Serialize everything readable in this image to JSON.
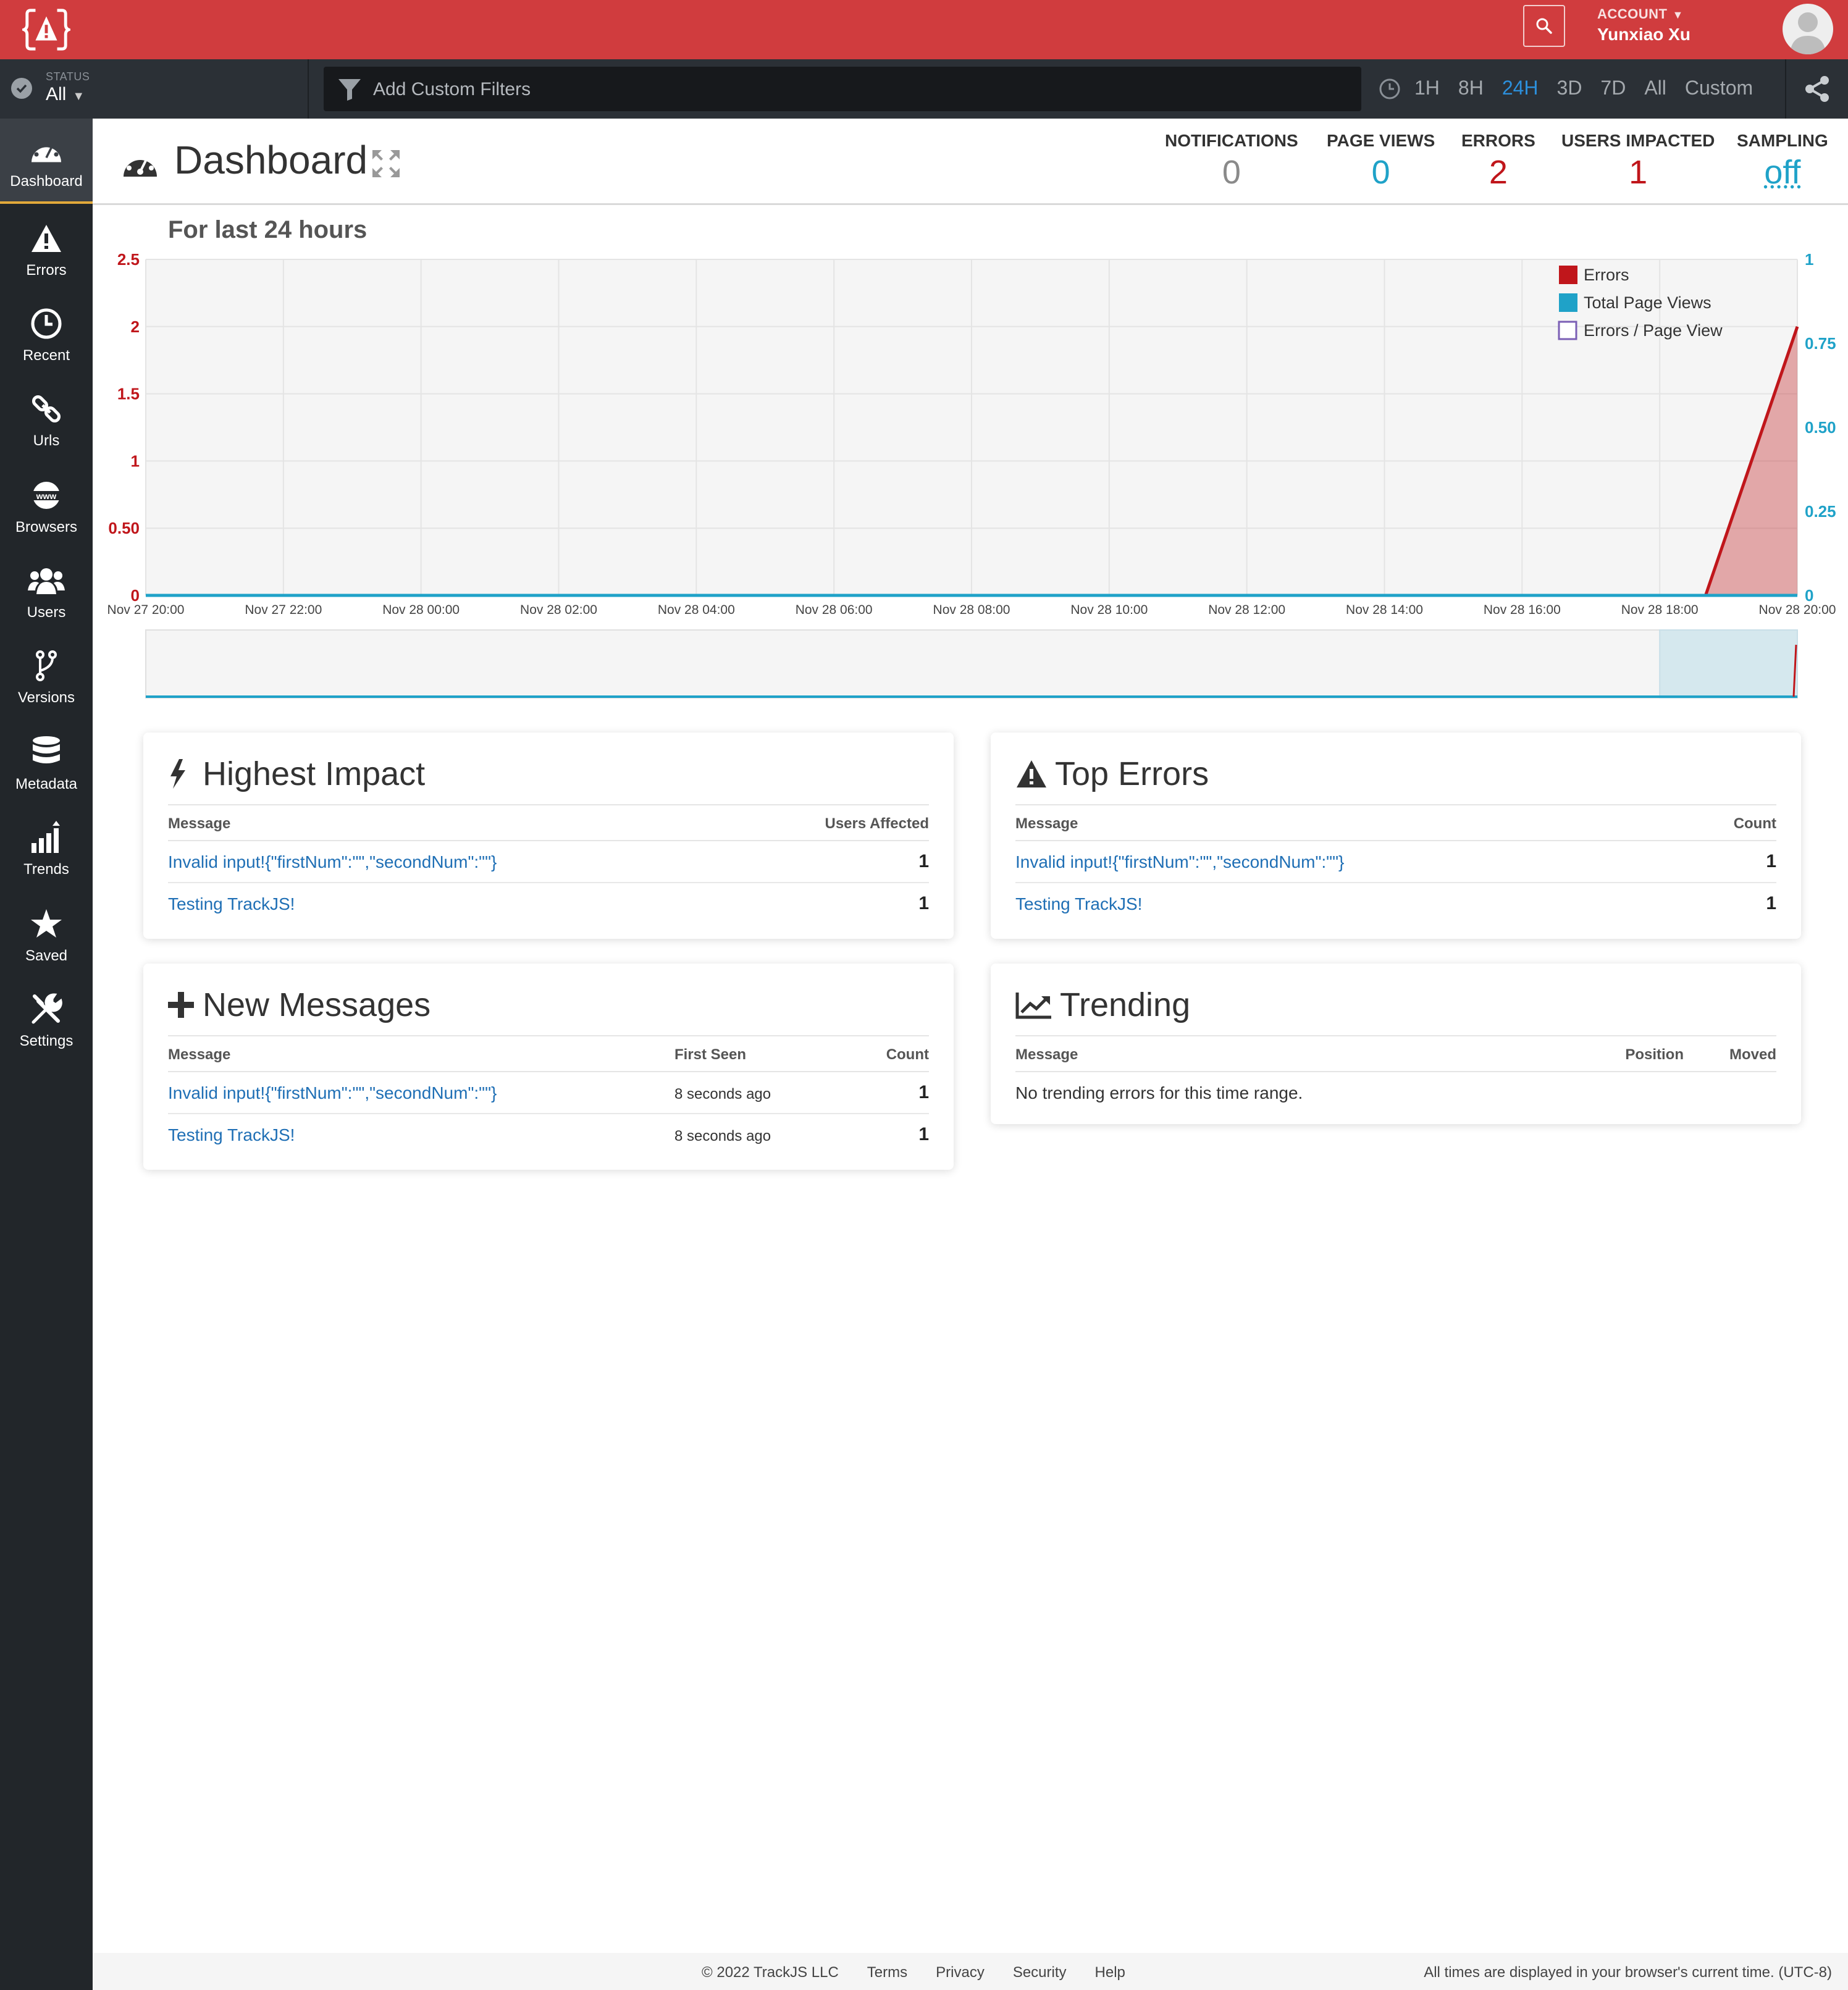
{
  "header": {
    "account_label": "ACCOUNT",
    "account_name": "Yunxiao Xu"
  },
  "filterbar": {
    "status_label": "STATUS",
    "status_value": "All",
    "filter_placeholder": "Add Custom Filters",
    "time_ranges": [
      "1H",
      "8H",
      "24H",
      "3D",
      "7D",
      "All",
      "Custom"
    ],
    "active_range": "24H"
  },
  "sidebar": {
    "items": [
      {
        "label": "Dashboard",
        "icon": "dashboard-icon"
      },
      {
        "label": "Errors",
        "icon": "warning-icon"
      },
      {
        "label": "Recent",
        "icon": "clock-icon"
      },
      {
        "label": "Urls",
        "icon": "link-icon"
      },
      {
        "label": "Browsers",
        "icon": "www-icon"
      },
      {
        "label": "Users",
        "icon": "users-icon"
      },
      {
        "label": "Versions",
        "icon": "branch-icon"
      },
      {
        "label": "Metadata",
        "icon": "database-icon"
      },
      {
        "label": "Trends",
        "icon": "trends-icon"
      },
      {
        "label": "Saved",
        "icon": "star-icon"
      },
      {
        "label": "Settings",
        "icon": "tools-icon"
      }
    ]
  },
  "page": {
    "title": "Dashboard",
    "stats": [
      {
        "label": "NOTIFICATIONS",
        "value": "0",
        "color": "#8a8a8a"
      },
      {
        "label": "PAGE VIEWS",
        "value": "0",
        "color": "#1fa2c8"
      },
      {
        "label": "ERRORS",
        "value": "2",
        "color": "#c0161b"
      },
      {
        "label": "USERS IMPACTED",
        "value": "1",
        "color": "#c0161b"
      },
      {
        "label": "SAMPLING",
        "value": "off",
        "color": "#1fa2c8"
      }
    ]
  },
  "chart_data": {
    "type": "area",
    "title": "For last 24 hours",
    "x": [
      "Nov 27 20:00",
      "Nov 27 22:00",
      "Nov 28 00:00",
      "Nov 28 02:00",
      "Nov 28 04:00",
      "Nov 28 06:00",
      "Nov 28 08:00",
      "Nov 28 10:00",
      "Nov 28 12:00",
      "Nov 28 14:00",
      "Nov 28 16:00",
      "Nov 28 18:00",
      "Nov 28 20:00"
    ],
    "y_left_ticks": [
      "0",
      "0.50",
      "1",
      "1.5",
      "2",
      "2.5"
    ],
    "y_left_lim": [
      0,
      2.5
    ],
    "y_right_ticks": [
      "0",
      "0.25",
      "0.50",
      "0.75",
      "1"
    ],
    "y_right_lim": [
      0,
      1
    ],
    "series": [
      {
        "name": "Errors",
        "color": "#c0161b",
        "axis": "left",
        "points": [
          [
            "Nov 27 20:00",
            0
          ],
          [
            "Nov 28 18:00",
            0
          ],
          [
            "Nov 28 18:40",
            0
          ],
          [
            "Nov 28 20:00",
            2
          ]
        ]
      },
      {
        "name": "Total Page Views",
        "color": "#1fa2c8",
        "axis": "right",
        "points": [
          [
            "Nov 27 20:00",
            0
          ],
          [
            "Nov 28 20:00",
            0
          ]
        ]
      },
      {
        "name": "Errors / Page View",
        "color": "#7b5fb5",
        "axis": "right",
        "points": []
      }
    ],
    "legend_position": "top-right",
    "grid": true
  },
  "panels": {
    "highest_impact": {
      "title": "Highest Impact",
      "col_message": "Message",
      "col_value": "Users Affected",
      "rows": [
        {
          "message": "Invalid input!{\"firstNum\":\"\",\"secondNum\":\"\"}",
          "value": "1"
        },
        {
          "message": "Testing TrackJS!",
          "value": "1"
        }
      ]
    },
    "top_errors": {
      "title": "Top Errors",
      "col_message": "Message",
      "col_value": "Count",
      "rows": [
        {
          "message": "Invalid input!{\"firstNum\":\"\",\"secondNum\":\"\"}",
          "value": "1"
        },
        {
          "message": "Testing TrackJS!",
          "value": "1"
        }
      ]
    },
    "new_messages": {
      "title": "New Messages",
      "col_message": "Message",
      "col_seen": "First Seen",
      "col_value": "Count",
      "rows": [
        {
          "message": "Invalid input!{\"firstNum\":\"\",\"secondNum\":\"\"}",
          "seen": "8 seconds ago",
          "value": "1"
        },
        {
          "message": "Testing TrackJS!",
          "seen": "8 seconds ago",
          "value": "1"
        }
      ]
    },
    "trending": {
      "title": "Trending",
      "col_message": "Message",
      "col_position": "Position",
      "col_moved": "Moved",
      "empty": "No trending errors for this time range."
    }
  },
  "footer": {
    "copyright": "© 2022 TrackJS LLC",
    "links": [
      "Terms",
      "Privacy",
      "Security",
      "Help"
    ],
    "timezone_note": "All times are displayed in your browser's current time. (UTC-8)"
  }
}
